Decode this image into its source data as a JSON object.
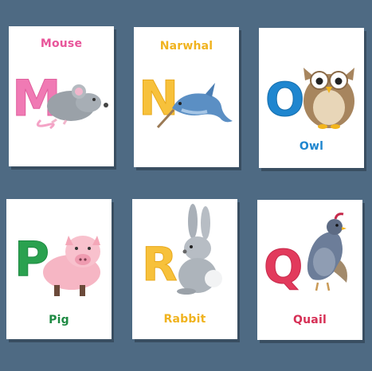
{
  "cards": [
    {
      "word": "Mouse",
      "letter": "M",
      "letter_color": "#f07ab4",
      "label_color": "#e8559a"
    },
    {
      "word": "Narwhal",
      "letter": "N",
      "letter_color": "#f7c13b",
      "label_color": "#f0b31f"
    },
    {
      "word": "Owl",
      "letter": "O",
      "letter_color": "#1f86cf",
      "label_color": "#1f86cf"
    },
    {
      "word": "Pig",
      "letter": "P",
      "letter_color": "#2aa14f",
      "label_color": "#1e8a43"
    },
    {
      "word": "Rabbit",
      "letter": "R",
      "letter_color": "#f7c13b",
      "label_color": "#f0b31f"
    },
    {
      "word": "Quail",
      "letter": "Q",
      "letter_color": "#e23a5c",
      "label_color": "#d62f55"
    }
  ],
  "background_color": "#4e6a83"
}
